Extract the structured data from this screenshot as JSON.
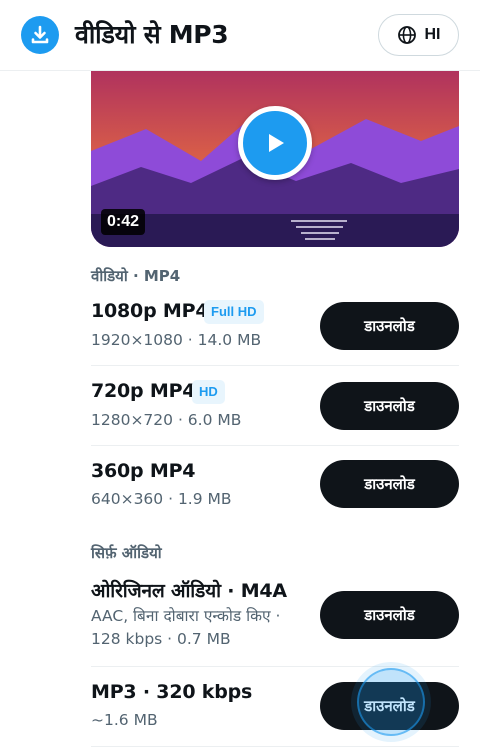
{
  "header": {
    "app_icon": "download-circle-icon",
    "title": "वीडियो से MP3",
    "lang_icon": "globe-icon",
    "lang_code": "HI"
  },
  "player": {
    "play_icon": "play-icon",
    "duration": "0:42"
  },
  "sections": {
    "video_label": "वीडियो · MP4",
    "audio_label": "सिर्फ़ ऑडियो"
  },
  "video_formats": [
    {
      "title": "1080p MP4",
      "badge": "Full HD",
      "details": "1920×1080 · 14.0 MB",
      "button": "डाउनलोड"
    },
    {
      "title": "720p MP4",
      "badge": "HD",
      "details": "1280×720 · 6.0 MB",
      "button": "डाउनलोड"
    },
    {
      "title": "360p MP4",
      "details": "640×360 · 1.9 MB",
      "button": "डाउनलोड"
    }
  ],
  "audio_formats": [
    {
      "title": "ओरिजिनल ऑडियो · M4A",
      "details_line1": "AAC, बिना दोबारा एन्कोड किए ·",
      "details_line2": "128 kbps · 0.7 MB",
      "button": "डाउनलोड"
    },
    {
      "title": "MP3 · 320 kbps",
      "details": "~1.6 MB",
      "button": "डाउनलोड"
    }
  ],
  "colors": {
    "accent": "#1d9bf0",
    "button_bg": "#0f1419",
    "badge_bg": "#e8f5fd",
    "muted_text": "#536471"
  }
}
